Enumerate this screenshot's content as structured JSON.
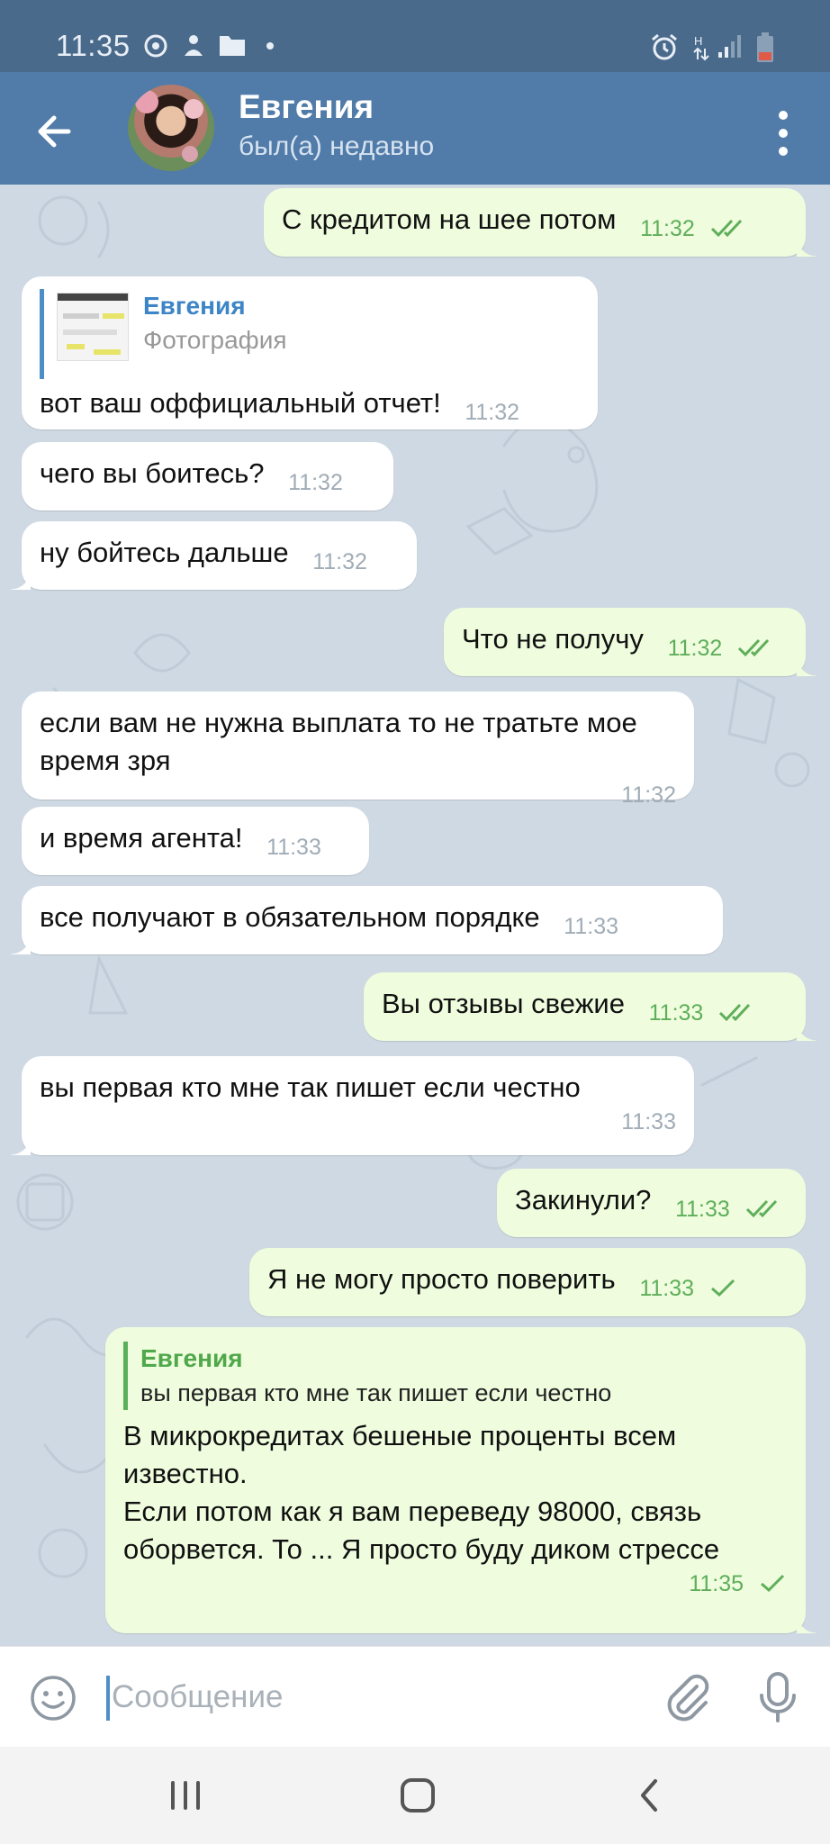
{
  "status_bar": {
    "time": "11:35"
  },
  "header": {
    "name": "Евгения",
    "status": "был(а) недавно"
  },
  "messages": [
    {
      "dir": "out",
      "text": "С кредитом на шее потом",
      "time": "11:32",
      "ticks": "double"
    },
    {
      "dir": "in",
      "reply_name": "Евгения",
      "reply_text": "Фотография",
      "text": "вот ваш оффициальный отчет!",
      "time": "11:32"
    },
    {
      "dir": "in",
      "text": "чего вы боитесь?",
      "time": "11:32"
    },
    {
      "dir": "in",
      "text": "ну бойтесь дальше",
      "time": "11:32"
    },
    {
      "dir": "out",
      "text": "Что не получу",
      "time": "11:32",
      "ticks": "double"
    },
    {
      "dir": "in",
      "text": "если вам не нужна выплата то не тратьте мое время зря",
      "time": "11:32"
    },
    {
      "dir": "in",
      "text": "и время агента!",
      "time": "11:33"
    },
    {
      "dir": "in",
      "text": "все получают в обязательном порядке",
      "time": "11:33"
    },
    {
      "dir": "out",
      "text": "Вы отзывы свежие",
      "time": "11:33",
      "ticks": "double"
    },
    {
      "dir": "in",
      "text": "вы первая кто мне так пишет если честно",
      "time": "11:33"
    },
    {
      "dir": "out",
      "text": "Закинули?",
      "time": "11:33",
      "ticks": "double"
    },
    {
      "dir": "out",
      "text": "Я не могу просто поверить",
      "time": "11:33",
      "ticks": "single"
    },
    {
      "dir": "out",
      "reply_name": "Евгения",
      "reply_text": "вы первая кто мне так пишет если честно",
      "text": "В микрокредитах бешеные проценты всем известно.\nЕсли потом как я вам переведу 98000, связь оборвется. То ... Я просто буду диком стрессе",
      "time": "11:35",
      "ticks": "single"
    }
  ],
  "input": {
    "placeholder": "Сообщение",
    "value": ""
  },
  "colors": {
    "header": "#517ba8",
    "status_bar": "#4a6a8c",
    "chat_bg": "#cfd9e3",
    "incoming": "#ffffff",
    "outgoing": "#effdde",
    "tick": "#5fae5a"
  },
  "icons": {
    "back": "arrow-left-icon",
    "menu": "more-vertical-icon",
    "emoji": "smile-icon",
    "attach": "paperclip-icon",
    "mic": "microphone-icon"
  }
}
